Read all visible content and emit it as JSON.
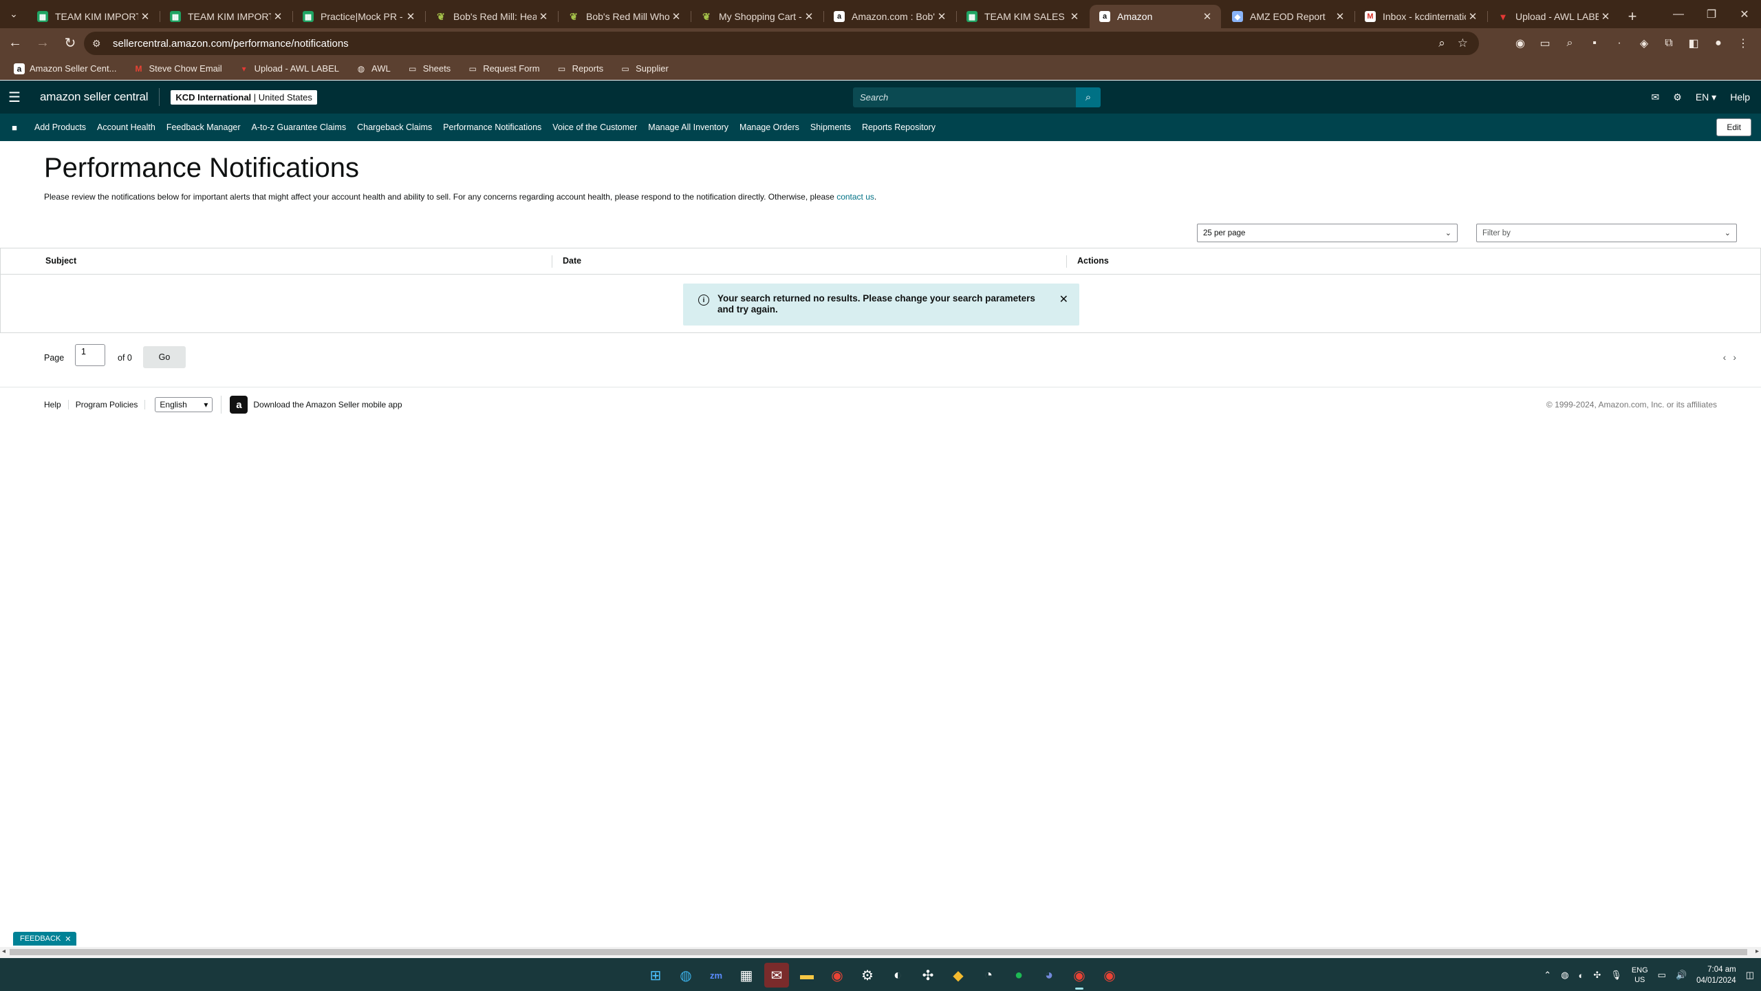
{
  "browser": {
    "tabs": [
      {
        "title": "TEAM KIM IMPORTANT",
        "favicon": "sheets-icon"
      },
      {
        "title": "TEAM KIM IMPORTANT",
        "favicon": "sheets-icon"
      },
      {
        "title": "Practice|Mock PR - Go",
        "favicon": "sheets-icon"
      },
      {
        "title": "Bob's Red Mill: Healthy",
        "favicon": "leaf-icon"
      },
      {
        "title": "Bob's Red Mill Whole V",
        "favicon": "leaf-icon"
      },
      {
        "title": "My Shopping Cart - Vi",
        "favicon": "leaf-icon"
      },
      {
        "title": "Amazon.com : Bob's R",
        "favicon": "amazon-icon"
      },
      {
        "title": "TEAM KIM SALES MON",
        "favicon": "sheets-icon"
      },
      {
        "title": "Amazon",
        "favicon": "amazon-icon",
        "active": true
      },
      {
        "title": "AMZ EOD Report",
        "favicon": "report-icon"
      },
      {
        "title": "Inbox - kcdinternation",
        "favicon": "gmail-icon"
      },
      {
        "title": "Upload - AWL LABEL",
        "favicon": "awl-icon"
      }
    ],
    "url": "sellercentral.amazon.com/performance/notifications",
    "bookmarks": [
      {
        "label": "Amazon Seller Cent...",
        "icon": "amazon-icon"
      },
      {
        "label": "Steve Chow Email",
        "icon": "gmail-icon"
      },
      {
        "label": "Upload - AWL LABEL",
        "icon": "awl-icon"
      },
      {
        "label": "AWL",
        "icon": "globe-icon"
      },
      {
        "label": "Sheets",
        "icon": "folder-icon"
      },
      {
        "label": "Request Form",
        "icon": "folder-icon"
      },
      {
        "label": "Reports",
        "icon": "folder-icon"
      },
      {
        "label": "Supplier",
        "icon": "folder-icon"
      }
    ]
  },
  "header": {
    "logo_text": "amazon seller central",
    "account_name": "KCD International",
    "account_region": "United States",
    "search_placeholder": "Search",
    "language": "EN",
    "help": "Help"
  },
  "nav": {
    "links": [
      "Add Products",
      "Account Health",
      "Feedback Manager",
      "A-to-z Guarantee Claims",
      "Chargeback Claims",
      "Performance Notifications",
      "Voice of the Customer",
      "Manage All Inventory",
      "Manage Orders",
      "Shipments",
      "Reports Repository"
    ],
    "edit": "Edit"
  },
  "main": {
    "title": "Performance Notifications",
    "description": "Please review the notifications below for important alerts that might affect your account health and ability to sell. For any concerns regarding account health, please respond to the notification directly. Otherwise, please",
    "contact_link": "contact us",
    "per_page": "25 per page",
    "filter_placeholder": "Filter by",
    "columns": {
      "subject": "Subject",
      "date": "Date",
      "actions": "Actions"
    },
    "alert_text": "Your search returned no results. Please change your search parameters and try again.",
    "pagination": {
      "page_label": "Page",
      "page_value": "1",
      "of_label": "of 0",
      "go": "Go"
    }
  },
  "footer": {
    "help": "Help",
    "policies": "Program Policies",
    "language": "English",
    "app_link": "Download the Amazon Seller mobile app",
    "copyright": "© 1999-2024, Amazon.com, Inc. or its affiliates"
  },
  "feedback": "FEEDBACK",
  "taskbar": {
    "lang_top": "ENG",
    "lang_bottom": "US",
    "time": "7:04 am",
    "date": "04/01/2024"
  },
  "colors": {
    "header_bg": "#002f36",
    "nav_bg": "#00434d",
    "link": "#007185",
    "alert_bg": "#d8eef0",
    "browser_frame": "#5b4030"
  }
}
